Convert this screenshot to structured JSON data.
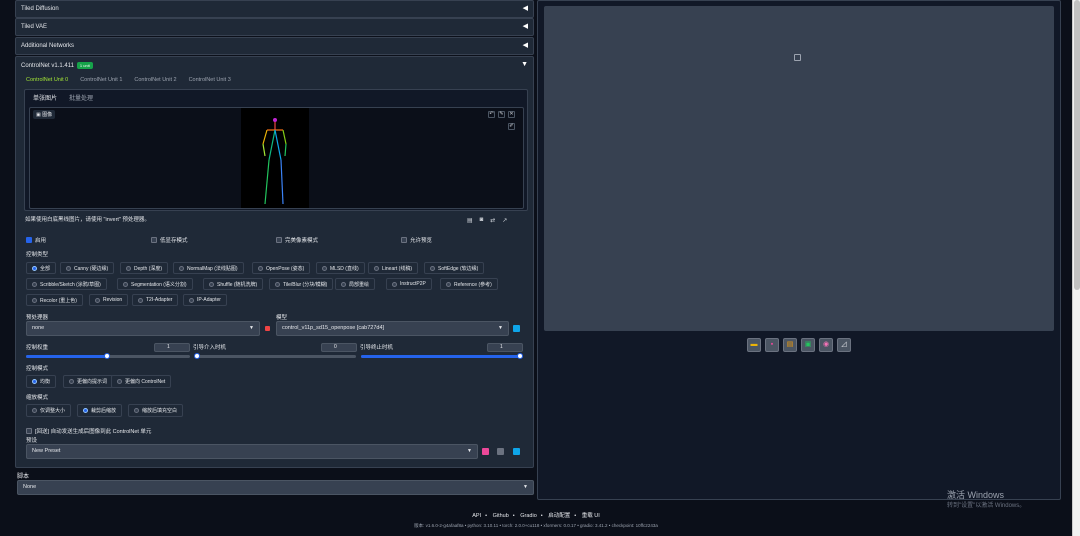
{
  "accordions": {
    "tiled_diffusion": "Tiled Diffusion",
    "tiled_vae": "Tiled VAE",
    "additional_networks": "Additional Networks"
  },
  "controlnet": {
    "title": "ControlNet v1.1.411",
    "badge": "1 unit",
    "units": [
      "ControlNet Unit 0",
      "ControlNet Unit 1",
      "ControlNet Unit 2",
      "ControlNet Unit 3"
    ],
    "image_tabs": [
      "单张图片",
      "批量处理"
    ],
    "image_label": "图像",
    "hint": "如果使用白底黑线图片，请使用 \"invert\" 预处理器。",
    "checkboxes": {
      "enable": "启用",
      "low_vram": "低显存模式",
      "pixel_perfect": "完美像素模式",
      "allow_preview": "允许预览"
    },
    "control_type_label": "控制类型",
    "control_types": [
      "全部",
      "Canny (硬边缘)",
      "Depth (深度)",
      "NormalMap (法线贴图)",
      "OpenPose (姿态)",
      "MLSD (直线)",
      "Lineart (线稿)",
      "SoftEdge (软边缘)",
      "Scribble/Sketch (涂鸦/草图)",
      "Segmentation (语义分割)",
      "Shuffle (随机洗牌)",
      "Tile/Blur (分块/模糊)",
      "局部重绘",
      "InstructP2P",
      "Reference (参考)",
      "Recolor (重上色)",
      "Revision",
      "T2I-Adapter",
      "IP-Adapter"
    ],
    "preprocessor_label": "预处理器",
    "preprocessor_value": "none",
    "model_label": "模型",
    "model_value": "control_v11p_sd15_openpose [cab727d4]",
    "weight_label": "控制权重",
    "weight_value": "1",
    "start_label": "引导介入时机",
    "start_value": "0",
    "end_label": "引导终止时机",
    "end_value": "1",
    "control_mode_label": "控制模式",
    "control_modes": [
      "均衡",
      "更偏向提示词",
      "更偏向 ControlNet"
    ],
    "resize_mode_label": "缩放模式",
    "resize_modes": [
      "仅调整大小",
      "裁剪后缩放",
      "缩放后填充空白"
    ],
    "loopback": "[回送] 自动发送生成后图像到此 ControlNet 单元",
    "preset_label": "预设",
    "preset_value": "New Preset"
  },
  "script": {
    "label": "脚本",
    "value": "None"
  },
  "footer": {
    "links": [
      "API",
      "Github",
      "Gradio",
      "启动配置",
      "重载 UI"
    ],
    "version": "版本: v1.6.0-2-g4afaaf8a  •  python: 3.10.11  •  torch: 2.0.0+cu118  •  xformers: 0.0.17  •  gradio: 3.41.2  •  checkpoint: 10ffc2243a"
  },
  "watermark": {
    "line1": "激活 Windows",
    "line2": "转到\"设置\"以激活 Windows。"
  }
}
